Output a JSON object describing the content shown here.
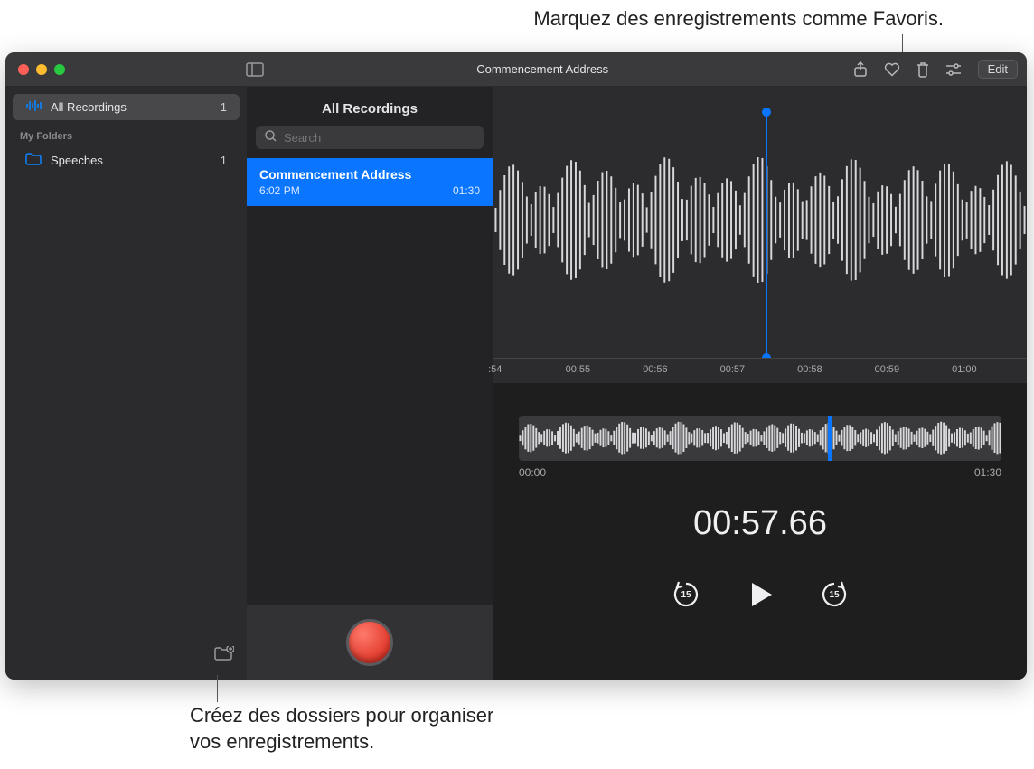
{
  "callouts": {
    "top": "Marquez des enregistrements comme Favoris.",
    "bottom": "Créez des dossiers pour organiser\nvos enregistrements."
  },
  "titlebar": {
    "title": "Commencement Address",
    "edit": "Edit"
  },
  "sidebar": {
    "all_recordings": "All Recordings",
    "all_count": "1",
    "section": "My Folders",
    "folders": [
      {
        "name": "Speeches",
        "count": "1"
      }
    ]
  },
  "list": {
    "header": "All Recordings",
    "search_placeholder": "Search",
    "items": [
      {
        "title": "Commencement Address",
        "time": "6:02 PM",
        "duration": "01:30"
      }
    ]
  },
  "ruler": {
    "ticks": [
      ":54",
      "00:55",
      "00:56",
      "00:57",
      "00:58",
      "00:59",
      "01:00"
    ]
  },
  "overview": {
    "start": "00:00",
    "end": "01:30"
  },
  "current_time": "00:57.66",
  "skip_seconds": "15"
}
